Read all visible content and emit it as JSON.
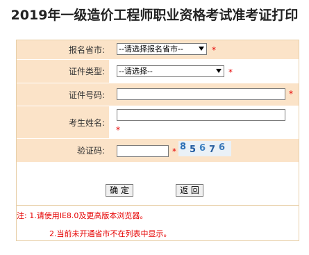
{
  "page": {
    "title": "2019年一级造价工程师职业资格考试准考证打印"
  },
  "form": {
    "province": {
      "label": "报名省市:",
      "selected": "--请选择报名省市--",
      "required_mark": "*"
    },
    "id_type": {
      "label": "证件类型:",
      "selected": "--请选择--",
      "required_mark": "*"
    },
    "id_number": {
      "label": "证件号码:",
      "value": "",
      "required_mark": "*"
    },
    "name": {
      "label": "考生姓名:",
      "value": "",
      "required_mark": "*"
    },
    "captcha": {
      "label": "验证码:",
      "value": "",
      "required_mark": "*",
      "image_text": [
        "8",
        "5",
        "6",
        "7",
        "6"
      ]
    }
  },
  "buttons": {
    "confirm": "确 定",
    "back": "返 回"
  },
  "notes": {
    "line1": "注: 1.请使用IE8.0及更高版本浏览器。",
    "line2": "2.当前未开通省市不在列表中显示。"
  },
  "colors": {
    "label_bg": "#fbe3c8",
    "border": "#e8cfa8",
    "required": "#e60000"
  }
}
